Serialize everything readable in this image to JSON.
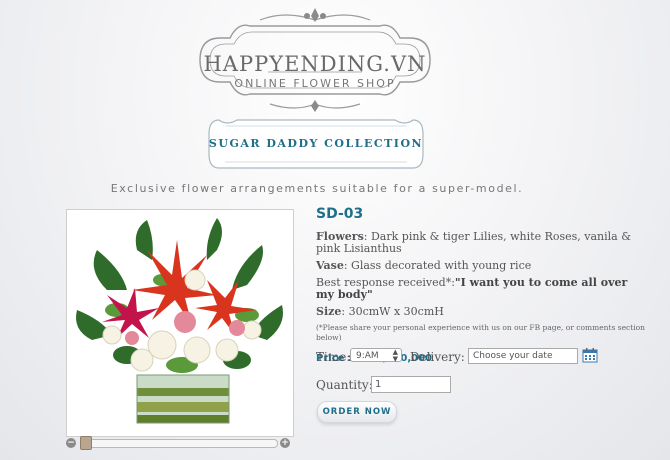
{
  "header": {
    "brand": "HAPPYENDING.VN",
    "subtitle": "ONLINE FLOWER SHOP",
    "collection": "SUGAR DADDY COLLECTION",
    "tagline": "Exclusive flower arrangements suitable for a super-model."
  },
  "product": {
    "code": "SD-03",
    "flowers_label": "Flowers",
    "flowers": ": Dark pink & tiger Lilies, white Roses, vanila & pink Lisianthus",
    "vase_label": "Vase",
    "vase": ": Glass decorated with young rice",
    "response_prefix": "Best response received*:",
    "response_quote": "\"I want you to come all over my body\"",
    "size_label": "Size",
    "size": ": 30cmW x 30cmH",
    "note": "(*Please share your personal experience with us on our FB page, or comments section below)",
    "price_label": "Price :",
    "price": "đ 1,150,000"
  },
  "order": {
    "time_label": "Time:",
    "time_value": "9:AM",
    "delivery_label": "Delivery:",
    "date_value": "Choose your date",
    "quantity_label": "Quantity:",
    "quantity_value": "1",
    "order_button": "ORDER NOW"
  },
  "colors": {
    "accent": "#1f6f8b",
    "text": "#555555"
  },
  "icons": {
    "calendar": "calendar-icon",
    "zoom_out": "minus-icon",
    "zoom_in": "plus-icon"
  }
}
